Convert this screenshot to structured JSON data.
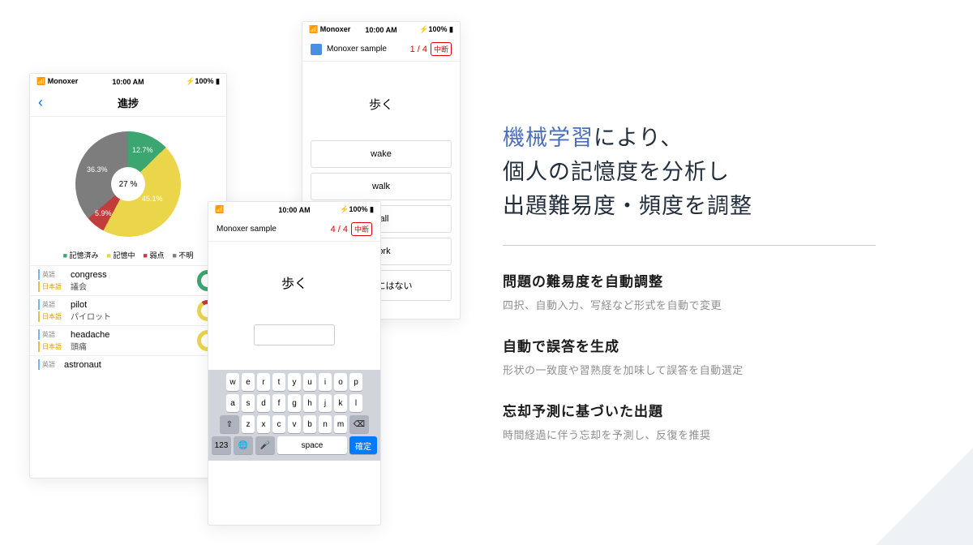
{
  "status": {
    "carrier": "Monoxer",
    "time": "10:00 AM",
    "battery": "100%"
  },
  "phone1": {
    "title": "進捗",
    "pie_center": "27 %",
    "legend": {
      "memorized": "記憶済み",
      "memorizing": "記憶中",
      "weak": "弱点",
      "unknown": "不明"
    },
    "rows": [
      {
        "en_tag": "英語",
        "en": "congress",
        "jp_tag": "日本語",
        "jp": "議会",
        "ring": "green"
      },
      {
        "en_tag": "英語",
        "en": "pilot",
        "jp_tag": "日本語",
        "jp": "パイロット",
        "ring": "red"
      },
      {
        "en_tag": "英語",
        "en": "headache",
        "jp_tag": "日本語",
        "jp": "頭痛",
        "ring": "yellow"
      },
      {
        "en_tag": "英語",
        "en": "astronaut",
        "jp_tag": "",
        "jp": "",
        "ring": ""
      }
    ]
  },
  "phone2": {
    "nav_title": "Monoxer sample",
    "counter": "4 / 4",
    "stop": "中断",
    "prompt": "歩く",
    "keys": {
      "row1": [
        "w",
        "e",
        "r",
        "t",
        "y",
        "u",
        "i",
        "o",
        "p"
      ],
      "row2": [
        "a",
        "s",
        "d",
        "f",
        "g",
        "h",
        "j",
        "k",
        "l"
      ],
      "row3_shift": "⇧",
      "row3": [
        "z",
        "x",
        "c",
        "v",
        "b",
        "n",
        "m"
      ],
      "row3_del": "⌫",
      "num": "123",
      "globe": "🌐",
      "mic": "🎤",
      "space": "space",
      "confirm": "確定"
    }
  },
  "phone3": {
    "nav_title": "Monoxer sample",
    "counter": "1 / 4",
    "stop": "中断",
    "prompt": "歩く",
    "choices": [
      "wake",
      "walk",
      "wall",
      "work",
      "この中にはない"
    ]
  },
  "headline": {
    "hl": "機械学習",
    "l1": "により、",
    "l2": "個人の記憶度を分析し",
    "l3": "出題難易度・頻度を調整"
  },
  "features": [
    {
      "h": "問題の難易度を自動調整",
      "p": "四択、自動入力、写経など形式を自動で変更"
    },
    {
      "h": "自動で誤答を生成",
      "p": "形状の一致度や習熟度を加味して誤答を自動選定"
    },
    {
      "h": "忘却予測に基づいた出題",
      "p": "時間経過に伴う忘却を予測し、反復を推奨"
    }
  ],
  "chart_data": {
    "type": "pie",
    "title": "進捗",
    "series": [
      {
        "name": "記憶済み",
        "value": 12.7,
        "color": "#3ba670"
      },
      {
        "name": "記憶中",
        "value": 45.1,
        "color": "#ead54b"
      },
      {
        "name": "弱点",
        "value": 5.9,
        "color": "#c23c3c"
      },
      {
        "name": "不明",
        "value": 36.3,
        "color": "#7d7d7d"
      }
    ],
    "center_label": "27 %"
  }
}
